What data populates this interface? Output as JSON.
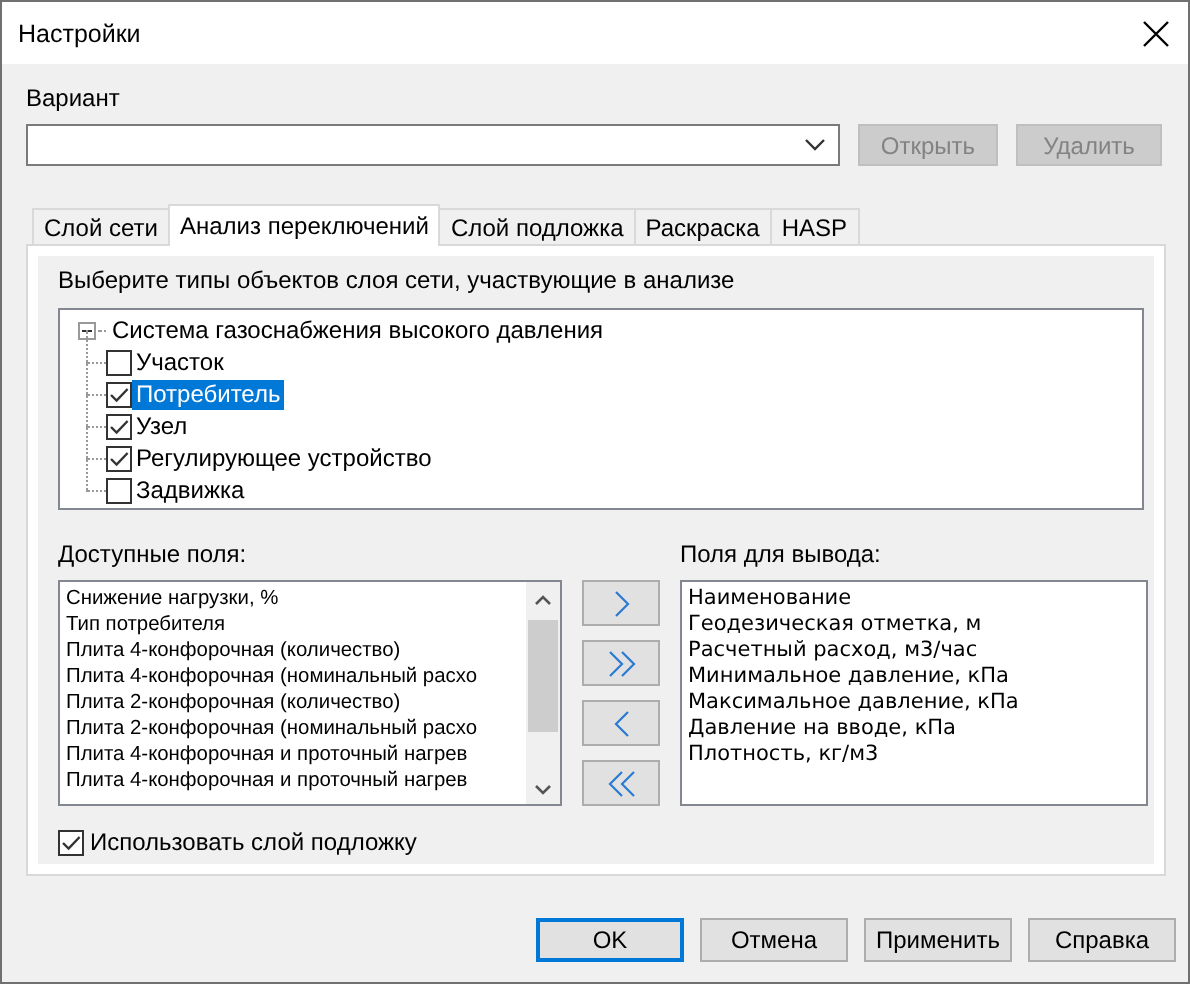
{
  "window": {
    "title": "Настройки"
  },
  "variant": {
    "label": "Вариант"
  },
  "variant_buttons": [
    {
      "label": "Открыть",
      "disabled": true
    },
    {
      "label": "Удалить",
      "disabled": true
    }
  ],
  "tabs": [
    {
      "label": "Слой сети",
      "selected": false
    },
    {
      "label": "Анализ переключений",
      "selected": true
    },
    {
      "label": "Слой подложка",
      "selected": false
    },
    {
      "label": "Раскраска",
      "selected": false
    },
    {
      "label": "HASP",
      "selected": false
    }
  ],
  "instruction": "Выберите типы объектов слоя сети, участвующие в анализе",
  "tree": {
    "label": "Система газоснабжения высокого давления",
    "expanded": true,
    "children": [
      {
        "label": "Участок",
        "checked": false,
        "selected": false
      },
      {
        "label": "Потребитель",
        "checked": true,
        "selected": true
      },
      {
        "label": "Узел",
        "checked": true,
        "selected": false
      },
      {
        "label": "Регулирующее устройство",
        "checked": true,
        "selected": false
      },
      {
        "label": "Задвижка",
        "checked": false,
        "selected": false
      }
    ]
  },
  "available_fields": {
    "label": "Доступные поля:",
    "items": [
      "Снижение нагрузки, %",
      "Тип потребителя",
      "Плита 4-конфорочная (количество)",
      "Плита 4-конфорочная (номинальный расхо",
      "Плита 2-конфорочная (количество)",
      "Плита 2-конфорочная (номинальный расхо",
      "Плита 4-конфорочная и проточный нагрев",
      "Плита 4-конфорочная и проточный нагрев"
    ]
  },
  "move_buttons": [
    {
      "kind": "add"
    },
    {
      "kind": "add_all"
    },
    {
      "kind": "remove"
    },
    {
      "kind": "remove_all"
    }
  ],
  "output_fields": {
    "label": "Поля для вывода:",
    "items": [
      "Наименование",
      "Геодезическая отметка, м",
      "Расчетный расход, м3/час",
      "Минимальное давление,  кПа",
      "Максимальное давление,  кПа",
      "Давление на вводе,  кПа",
      "Плотность, кг/м3"
    ]
  },
  "use_underlay": {
    "label": "Использовать слой подложку",
    "checked": true
  },
  "buttons": [
    {
      "label": "OK",
      "default": true
    },
    {
      "label": "Отмена",
      "default": false
    },
    {
      "label": "Применить",
      "default": false
    },
    {
      "label": "Справка",
      "default": false
    }
  ]
}
